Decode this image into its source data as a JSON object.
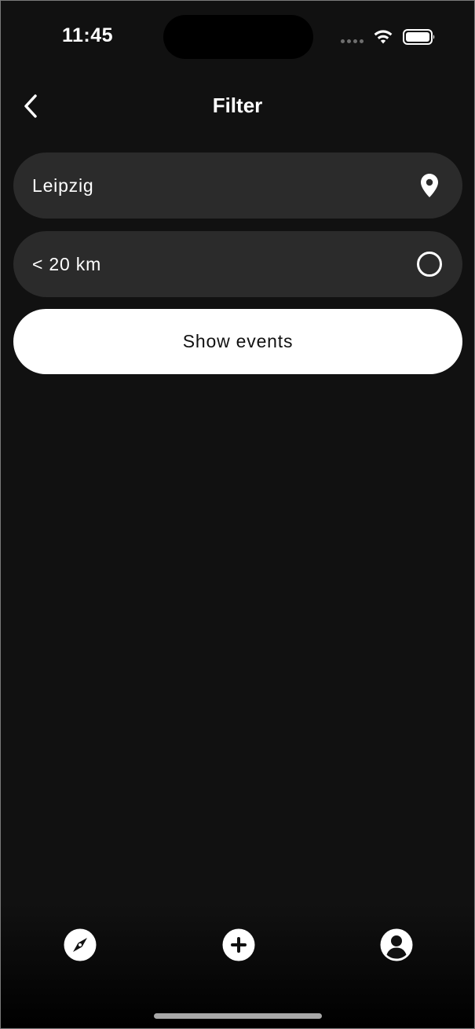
{
  "status_bar": {
    "time": "11:45"
  },
  "nav": {
    "title": "Filter",
    "back_icon": "chevron-left-icon"
  },
  "filters": {
    "location": {
      "value": "Leipzig",
      "icon": "location-pin-icon"
    },
    "radius": {
      "value": "< 20 km",
      "icon": "radio-circle-icon"
    }
  },
  "actions": {
    "show_events_label": "Show events"
  },
  "tab_bar": {
    "items": [
      {
        "name": "explore",
        "icon": "compass-icon"
      },
      {
        "name": "add",
        "icon": "plus-circle-icon"
      },
      {
        "name": "profile",
        "icon": "profile-icon"
      }
    ]
  },
  "colors": {
    "background": "#111111",
    "field": "#2b2b2b",
    "accent": "#ffffff"
  }
}
